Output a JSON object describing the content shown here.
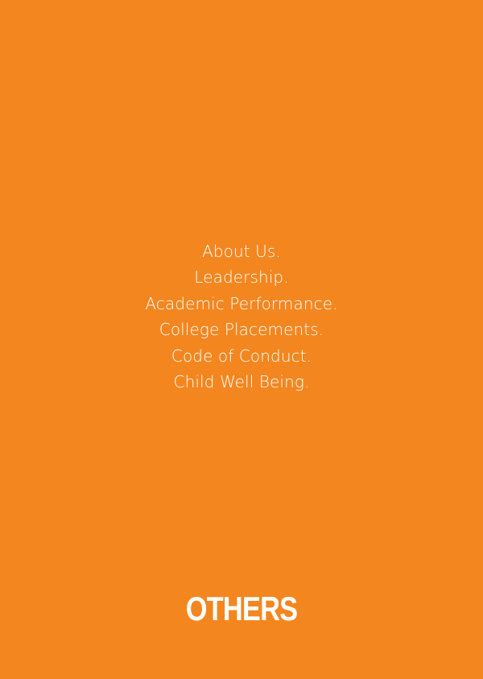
{
  "colors": {
    "background": "#f4861f",
    "text": "#ffffff"
  },
  "menu": {
    "items": [
      {
        "label": "About Us."
      },
      {
        "label": "Leadership."
      },
      {
        "label": "Academic Performance."
      },
      {
        "label": "College Placements."
      },
      {
        "label": "Code of Conduct."
      },
      {
        "label": "Child Well Being."
      }
    ]
  },
  "footer": {
    "title": "OTHERS"
  }
}
